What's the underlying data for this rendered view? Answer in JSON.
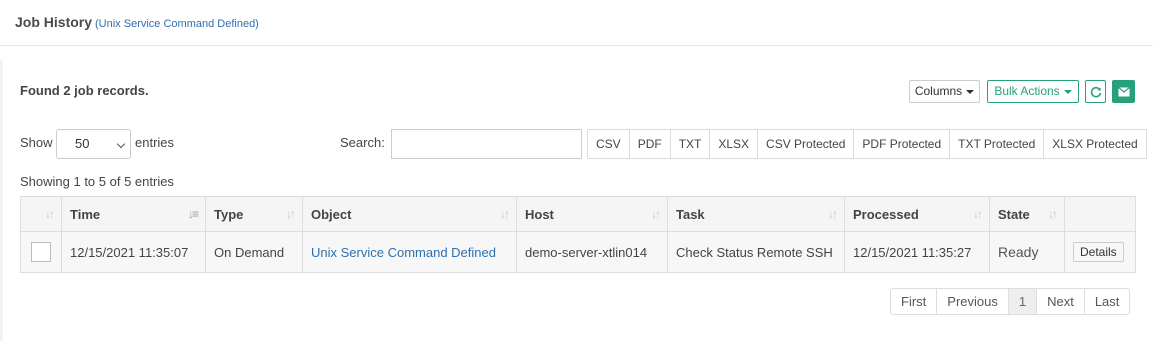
{
  "header": {
    "title": "Job History",
    "subtitle": "(Unix Service Command Defined)"
  },
  "summary": {
    "found_text": "Found 2 job records."
  },
  "toolbar": {
    "columns_label": "Columns",
    "bulk_actions_label": "Bulk Actions",
    "refresh_icon": "refresh-icon",
    "email_icon": "envelope-icon"
  },
  "length": {
    "show_label": "Show",
    "selected": "50",
    "entries_label": "entries"
  },
  "search": {
    "label": "Search:",
    "value": ""
  },
  "exports": [
    "CSV",
    "PDF",
    "TXT",
    "XLSX",
    "CSV Protected",
    "PDF Protected",
    "TXT Protected",
    "XLSX Protected"
  ],
  "info": "Showing 1 to 5 of 5 entries",
  "table": {
    "columns": [
      "",
      "Time",
      "Type",
      "Object",
      "Host",
      "Task",
      "Processed",
      "State",
      ""
    ],
    "rows": [
      {
        "time": "12/15/2021 11:35:07",
        "type": "On Demand",
        "object": "Unix Service Command Defined",
        "host": "demo-server-xtlin014",
        "task": "Check Status Remote SSH",
        "processed": "12/15/2021 11:35:27",
        "state": "Ready",
        "action": "Details"
      }
    ]
  },
  "pagination": [
    "First",
    "Previous",
    "1",
    "Next",
    "Last"
  ],
  "colors": {
    "accent_green": "#27a17c",
    "link_blue": "#2f6fb0"
  }
}
